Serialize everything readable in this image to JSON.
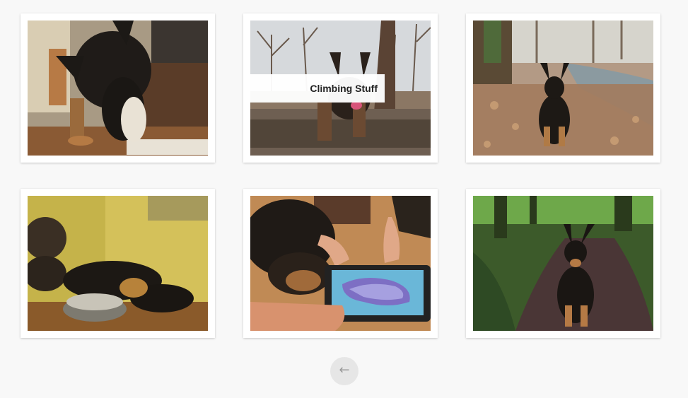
{
  "gallery": {
    "photos": [
      {
        "subject": "dog eating from plate in kitchen",
        "caption": ""
      },
      {
        "subject": "dog standing on fallen log in forest",
        "caption": "Climbing Stuff"
      },
      {
        "subject": "dog sitting by forest stream on leaves",
        "caption": ""
      },
      {
        "subject": "puppies sleeping next to food bowl",
        "caption": ""
      },
      {
        "subject": "dog watching tablet game on wooden floor",
        "caption": ""
      },
      {
        "subject": "dog sitting on forest path",
        "caption": ""
      }
    ]
  },
  "pagination": {
    "back_icon": "←",
    "icon_name": "arrow-left-icon"
  }
}
